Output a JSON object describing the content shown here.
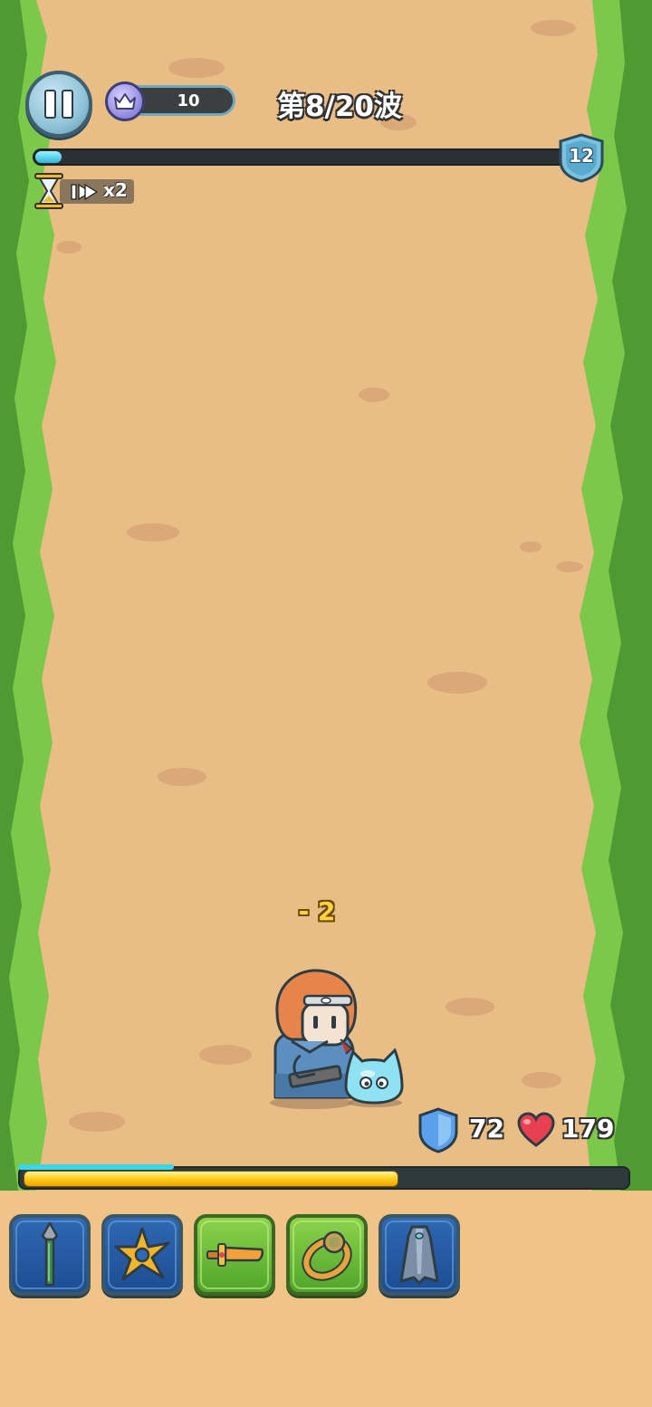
{
  "hud": {
    "crown_count": "10",
    "wave_label": "第8/20波",
    "wave_progress": 0.05,
    "level": "12",
    "speed_label": "x2"
  },
  "combat": {
    "damage_text": "- 2"
  },
  "player": {
    "shield": "72",
    "health": "179",
    "hp_fraction": 0.62
  },
  "skills": [
    {
      "name": "spear-icon",
      "state": "locked-blue"
    },
    {
      "name": "shuriken-icon",
      "state": "locked-blue"
    },
    {
      "name": "sword-icon",
      "state": "active-green"
    },
    {
      "name": "ring-icon",
      "state": "active-green"
    },
    {
      "name": "cloak-icon",
      "state": "locked-blue"
    }
  ],
  "colors": {
    "path": "#e9bd86",
    "grass": "#7cc84a",
    "hp_fill": "#ffd21e",
    "wave_fill": "#2cb8db"
  }
}
